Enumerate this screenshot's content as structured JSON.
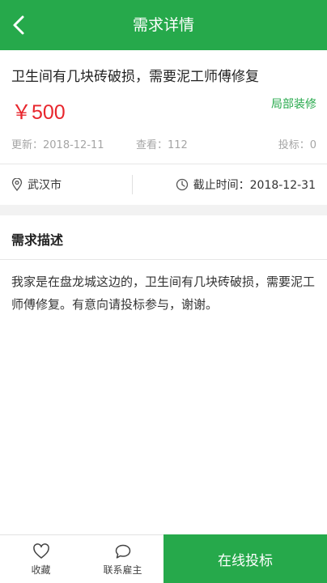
{
  "header": {
    "title": "需求详情"
  },
  "request": {
    "title": "卫生间有几块砖破损，需要泥工师傅修复",
    "price": "￥500",
    "category": "局部装修",
    "updated": "更新：2018-12-11",
    "views": "查看：112",
    "bids": "投标：0",
    "location": "武汉市",
    "deadline": "截止时间：2018-12-31"
  },
  "description": {
    "heading": "需求描述",
    "text": "我家是在盘龙城这边的，卫生间有几块砖破损，需要泥工师傅修复。有意向请投标参与，谢谢。"
  },
  "bottom": {
    "favorite_label": "收藏",
    "contact_label": "联系雇主",
    "bid_label": "在线投标"
  },
  "colors": {
    "brand": "#26a94b",
    "price": "#e8262d"
  },
  "icons": [
    "back-arrow-icon",
    "location-pin-icon",
    "clock-icon",
    "heart-icon",
    "chat-bubble-icon"
  ]
}
